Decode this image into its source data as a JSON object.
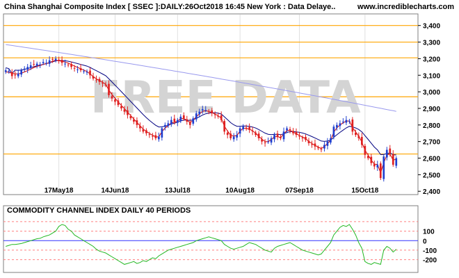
{
  "header": {
    "title": "China Shanghai Composite Index [ SSEC ]:DAILY:26Oct2018 16:45 New York : Data Delaye..",
    "site": "www.incrediblecharts.com"
  },
  "watermark": "FREE DATA",
  "chart_data": [
    {
      "type": "candlestick",
      "title": "China Shanghai Composite Index [ SSEC ]:DAILY:26Oct2018 16:45 New York : Data Delaye..",
      "ylim": [
        2380,
        3470
      ],
      "y_ticks": [
        2400,
        2500,
        2600,
        2700,
        2800,
        2900,
        3000,
        3100,
        3200,
        3300,
        3400
      ],
      "y_tick_labels": [
        "2,400",
        "2,500",
        "2,600",
        "2,700",
        "2,800",
        "2,900",
        "3,000",
        "3,100",
        "3,200",
        "3,300",
        "3,400"
      ],
      "x_tick_labels": [
        "17May18",
        "14Jun18",
        "13Jul18",
        "10Aug18",
        "07Sep18",
        "15Oct18"
      ],
      "x_tick_index": [
        17,
        35,
        55,
        75,
        94,
        115
      ],
      "horizontal_lines": [
        3400,
        3300,
        3205,
        2970,
        2625
      ],
      "bar_count": 126,
      "close": [
        3130,
        3125,
        3095,
        3100,
        3110,
        3130,
        3140,
        3150,
        3160,
        3165,
        3170,
        3165,
        3180,
        3175,
        3190,
        3195,
        3200,
        3185,
        3175,
        3170,
        3160,
        3150,
        3140,
        3135,
        3130,
        3125,
        3120,
        3100,
        3080,
        3070,
        3060,
        3050,
        3040,
        2980,
        2960,
        2940,
        2920,
        2900,
        2880,
        2860,
        2840,
        2820,
        2800,
        2780,
        2760,
        2750,
        2740,
        2730,
        2720,
        2730,
        2780,
        2800,
        2810,
        2830,
        2820,
        2830,
        2850,
        2840,
        2820,
        2800,
        2840,
        2870,
        2880,
        2895,
        2890,
        2880,
        2870,
        2860,
        2850,
        2830,
        2760,
        2740,
        2720,
        2730,
        2740,
        2780,
        2790,
        2780,
        2770,
        2760,
        2740,
        2720,
        2700,
        2690,
        2700,
        2720,
        2740,
        2730,
        2720,
        2760,
        2780,
        2770,
        2750,
        2740,
        2730,
        2720,
        2710,
        2690,
        2680,
        2670,
        2660,
        2650,
        2680,
        2700,
        2720,
        2790,
        2800,
        2810,
        2820,
        2830,
        2825,
        2760,
        2740,
        2720,
        2680,
        2620,
        2600,
        2570,
        2550,
        2560,
        2480,
        2610,
        2650,
        2630,
        2560,
        2600
      ],
      "ma_short": [
        3120,
        3118,
        3112,
        3108,
        3108,
        3112,
        3120,
        3128,
        3137,
        3146,
        3154,
        3158,
        3166,
        3170,
        3177,
        3184,
        3190,
        3188,
        3184,
        3180,
        3173,
        3165,
        3155,
        3147,
        3139,
        3131,
        3123,
        3108,
        3092,
        3079,
        3068,
        3057,
        3046,
        3010,
        2984,
        2961,
        2939,
        2918,
        2898,
        2877,
        2857,
        2836,
        2815,
        2795,
        2775,
        2761,
        2749,
        2738,
        2728,
        2729,
        2760,
        2781,
        2795,
        2813,
        2816,
        2823,
        2838,
        2839,
        2829,
        2814,
        2828,
        2851,
        2866,
        2882,
        2886,
        2882,
        2875,
        2866,
        2856,
        2841,
        2792,
        2763,
        2737,
        2733,
        2737,
        2763,
        2779,
        2779,
        2774,
        2766,
        2750,
        2732,
        2714,
        2700,
        2700,
        2712,
        2729,
        2730,
        2724,
        2746,
        2766,
        2768,
        2757,
        2747,
        2737,
        2727,
        2717,
        2701,
        2688,
        2677,
        2667,
        2657,
        2671,
        2688,
        2707,
        2757,
        2783,
        2800,
        2813,
        2824,
        2824,
        2785,
        2758,
        2733,
        2697,
        2648,
        2619,
        2588,
        2564,
        2562,
        2511,
        2572,
        2619,
        2625,
        2587,
        2595
      ]
    },
    {
      "type": "line",
      "title": "COMMODITY CHANNEL INDEX DAILY 40 PERIODS",
      "ylim": [
        -320,
        280
      ],
      "y_ticks": [
        100,
        0,
        -100,
        -200
      ],
      "y_tick_labels": [
        "100",
        "0",
        "-100",
        "-200"
      ],
      "reference_levels": [
        200,
        100,
        0,
        -100,
        -200
      ],
      "series": [
        {
          "values": [
            -60,
            -50,
            -40,
            -40,
            -35,
            -30,
            -20,
            -10,
            0,
            10,
            20,
            25,
            40,
            50,
            60,
            80,
            100,
            150,
            170,
            160,
            120,
            100,
            60,
            40,
            20,
            0,
            -20,
            -40,
            -60,
            -90,
            -110,
            -120,
            -130,
            -150,
            -170,
            -190,
            -210,
            -230,
            -250,
            -240,
            -230,
            -220,
            -240,
            -230,
            -210,
            -220,
            -200,
            -180,
            -190,
            -160,
            -140,
            -120,
            -100,
            -90,
            -80,
            -70,
            -60,
            -50,
            -40,
            -30,
            -20,
            0,
            10,
            20,
            30,
            40,
            30,
            20,
            10,
            0,
            -40,
            -60,
            -80,
            -90,
            -80,
            -70,
            -60,
            -40,
            -20,
            -30,
            -40,
            -60,
            -80,
            -100,
            -110,
            -120,
            -80,
            -60,
            -50,
            -40,
            -30,
            -20,
            -40,
            -60,
            -80,
            -100,
            -110,
            -120,
            -130,
            -140,
            -150,
            -140,
            -100,
            -60,
            -20,
            60,
            100,
            140,
            160,
            150,
            170,
            120,
            60,
            -20,
            -80,
            -220,
            -240,
            -250,
            -230,
            -240,
            -250,
            -100,
            -60,
            -80,
            -120,
            -90
          ]
        }
      ]
    }
  ],
  "colors": {
    "background": "#ffffff",
    "price_panel_bg": "#ffffff",
    "cci_panel_bg": "#ffffff",
    "hline": "#ffa500",
    "up_candle": "#1f3fcf",
    "down_candle": "#e02020",
    "ma_long": "#9999ee",
    "ma_mid": "#000080",
    "ma_short": "#d00000",
    "cci_line": "#22b822",
    "cci_zero": "#3030ff",
    "cci_dash": "#ff8080",
    "vgrid": "#e0e0e0"
  }
}
